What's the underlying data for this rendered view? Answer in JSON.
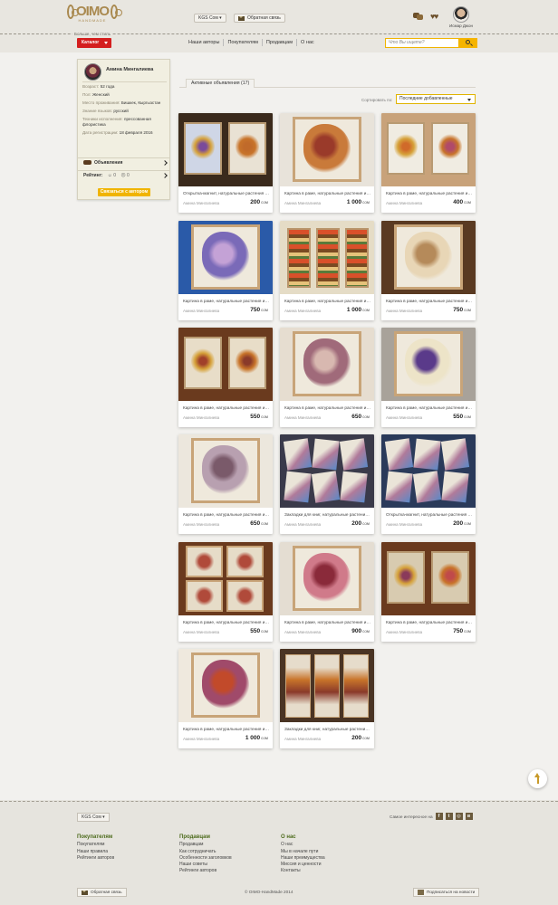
{
  "header": {
    "logo_text": "OIMO",
    "logo_sub": "HANDMADE",
    "slogan": "Больше, чем стиль",
    "currency": "KGS Сом",
    "feedback": "Обратная связь",
    "user_name": "Исмар Джон"
  },
  "nav": {
    "catalog": "Каталог",
    "items": [
      "Наши авторы",
      "Покупателям",
      "Продавцам",
      "О нас"
    ],
    "search_placeholder": "Что Вы ищете?"
  },
  "profile": {
    "name": "Амина Мингалиева",
    "rows": [
      {
        "label": "Возраст:",
        "value": "52 года"
      },
      {
        "label": "Пол:",
        "value": "Женский"
      },
      {
        "label": "Место проживания:",
        "value": "Бишкек, Кыргызстан"
      },
      {
        "label": "Знание языков:",
        "value": "русский"
      },
      {
        "label": "Техники исполнения:",
        "value": "прессованная флористика"
      },
      {
        "label": "Дата регистрации:",
        "value": "18 февраля 2016"
      }
    ],
    "ads_label": "Объявления",
    "rating_label": "Рейтинг:",
    "rating_likes": "0",
    "rating_dislikes": "0",
    "contact_button": "Связаться с автором"
  },
  "listing": {
    "tab_label": "Активные объявления (17)",
    "sort_label": "Сортировать по:",
    "sort_value": "Последние добавленные",
    "cards": [
      {
        "title": "Открытка-магнит, натуральные растения и…",
        "author": "Амина Мингалиева",
        "price": "200",
        "currency": "сом"
      },
      {
        "title": "Картина в раме, натуральные растения из…",
        "author": "Амина Мингалиева",
        "price": "1 000",
        "currency": "сом"
      },
      {
        "title": "Картина в раме, натуральные растения из…",
        "author": "Амина Мингалиева",
        "price": "400",
        "currency": "сом"
      },
      {
        "title": "Картина в раме, натуральные растения из…",
        "author": "Амина Мингалиева",
        "price": "750",
        "currency": "сом"
      },
      {
        "title": "Картина в раме, натуральные растения из…",
        "author": "Амина Мингалиева",
        "price": "1 000",
        "currency": "сом"
      },
      {
        "title": "Картина в раме, натуральные растения из…",
        "author": "Амина Мингалиева",
        "price": "750",
        "currency": "сом"
      },
      {
        "title": "Картина в раме, натуральные растения из…",
        "author": "Амина Мингалиева",
        "price": "550",
        "currency": "сом"
      },
      {
        "title": "Картина в раме, натуральные растения из…",
        "author": "Амина Мингалиева",
        "price": "650",
        "currency": "сом"
      },
      {
        "title": "Картина в раме, натуральные растения из…",
        "author": "Амина Мингалиева",
        "price": "550",
        "currency": "сом"
      },
      {
        "title": "Картина в раме, натуральные растения из…",
        "author": "Амина Мингалиева",
        "price": "650",
        "currency": "сом"
      },
      {
        "title": "Закладки для книг, натуральные растения…",
        "author": "Амина Мингалиева",
        "price": "200",
        "currency": "сом"
      },
      {
        "title": "Открытка-магнит, натуральные растения и…",
        "author": "Амина Мингалиева",
        "price": "200",
        "currency": "сом"
      },
      {
        "title": "Картина в раме, натуральные растения из…",
        "author": "Амина Мингалиева",
        "price": "550",
        "currency": "сом"
      },
      {
        "title": "Картина в раме, натуральные растения из…",
        "author": "Амина Мингалиева",
        "price": "900",
        "currency": "сом"
      },
      {
        "title": "Картина в раме, натуральные растения из…",
        "author": "Амина Мингалиева",
        "price": "750",
        "currency": "сом"
      },
      {
        "title": "Картина в раме, натуральные растения из…",
        "author": "Амина Мингалиева",
        "price": "1 000",
        "currency": "сом"
      },
      {
        "title": "Закладки для книг, натуральные растения…",
        "author": "Амина Мингалиева",
        "price": "200",
        "currency": "сом"
      }
    ]
  },
  "footer": {
    "currency": "KGS Сом",
    "social_label": "Самое интересное на",
    "columns": [
      {
        "heading": "Покупателям",
        "items": [
          "Покупателям",
          "Наши правила",
          "Рейтинги авторов"
        ]
      },
      {
        "heading": "Продавцам",
        "items": [
          "Продавцам",
          "Как сотрудничать",
          "Особенности заголовков",
          "Наши советы",
          "Рейтинги авторов"
        ]
      },
      {
        "heading": "О нас",
        "items": [
          "О нас",
          "Мы в начале пути",
          "Наши преимущества",
          "Миссия и ценности",
          "Контакты"
        ]
      }
    ],
    "feedback": "Обратная связь",
    "copyright": "© OIMO-HandMade 2014",
    "subscribe": "Подписаться на новости"
  },
  "colors": {
    "accent_red": "#d41e1e",
    "accent_yellow": "#f5b400",
    "footer_heading": "#4d6b1c"
  }
}
